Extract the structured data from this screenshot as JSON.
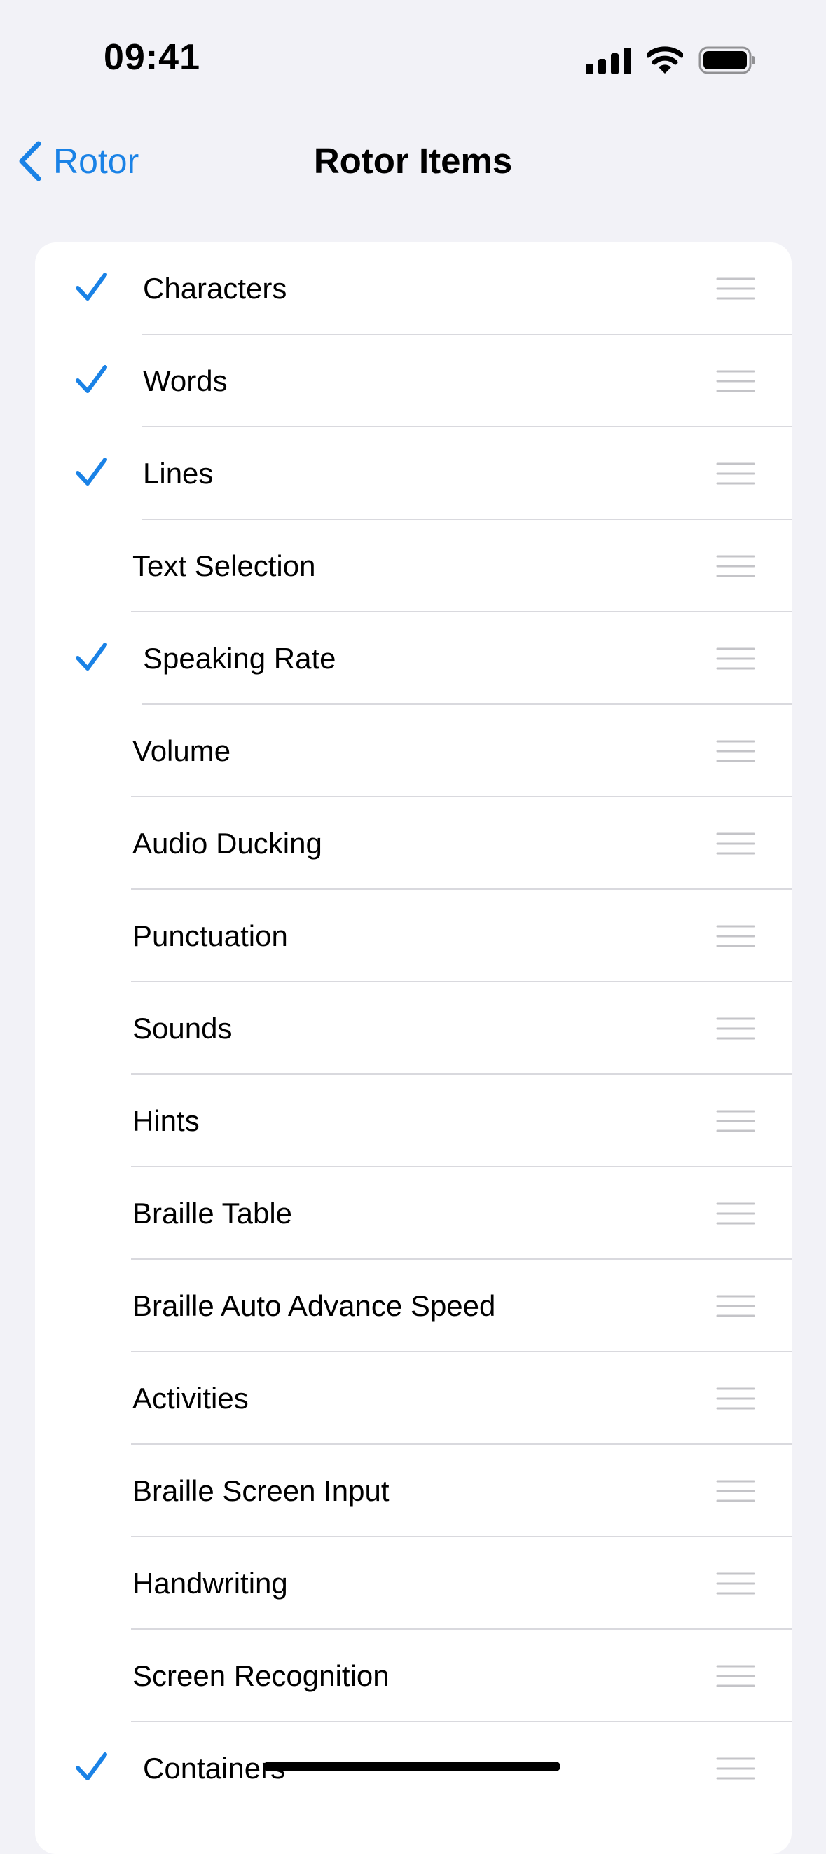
{
  "status_bar": {
    "time": "09:41"
  },
  "nav": {
    "back_label": "Rotor",
    "title": "Rotor Items"
  },
  "colors": {
    "accent": "#1a82e6",
    "background": "#f2f2f7",
    "separator": "#d9d9de"
  },
  "icons": {
    "back": "chevron-left-icon",
    "check": "checkmark-icon",
    "reorder": "reorder-handle-icon"
  },
  "rotor_items": [
    {
      "label": "Characters",
      "checked": true
    },
    {
      "label": "Words",
      "checked": true
    },
    {
      "label": "Lines",
      "checked": true
    },
    {
      "label": "Text Selection",
      "checked": false
    },
    {
      "label": "Speaking Rate",
      "checked": true
    },
    {
      "label": "Volume",
      "checked": false
    },
    {
      "label": "Audio Ducking",
      "checked": false
    },
    {
      "label": "Punctuation",
      "checked": false
    },
    {
      "label": "Sounds",
      "checked": false
    },
    {
      "label": "Hints",
      "checked": false
    },
    {
      "label": "Braille Table",
      "checked": false
    },
    {
      "label": "Braille Auto Advance Speed",
      "checked": false
    },
    {
      "label": "Activities",
      "checked": false
    },
    {
      "label": "Braille Screen Input",
      "checked": false
    },
    {
      "label": "Handwriting",
      "checked": false
    },
    {
      "label": "Screen Recognition",
      "checked": false
    },
    {
      "label": "Containers",
      "checked": true
    }
  ]
}
